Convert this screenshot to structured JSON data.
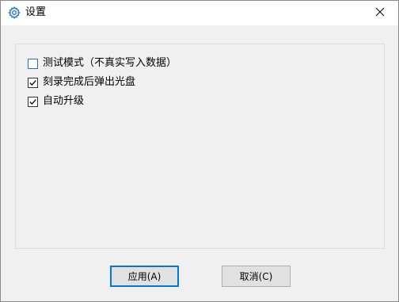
{
  "dialog": {
    "title": "设置",
    "icon": "gear-icon",
    "close_icon": "close-icon"
  },
  "options": [
    {
      "label": "测试模式（不真实写入数据）",
      "checked": false
    },
    {
      "label": "刻录完成后弹出光盘",
      "checked": true
    },
    {
      "label": "自动升级",
      "checked": true
    }
  ],
  "buttons": {
    "apply_label": "应用(A)",
    "cancel_label": "取消(C)"
  },
  "colors": {
    "accent": "#0078d7",
    "titlebar_bg": "#ffffff",
    "window_bg": "#f0f0f0"
  }
}
